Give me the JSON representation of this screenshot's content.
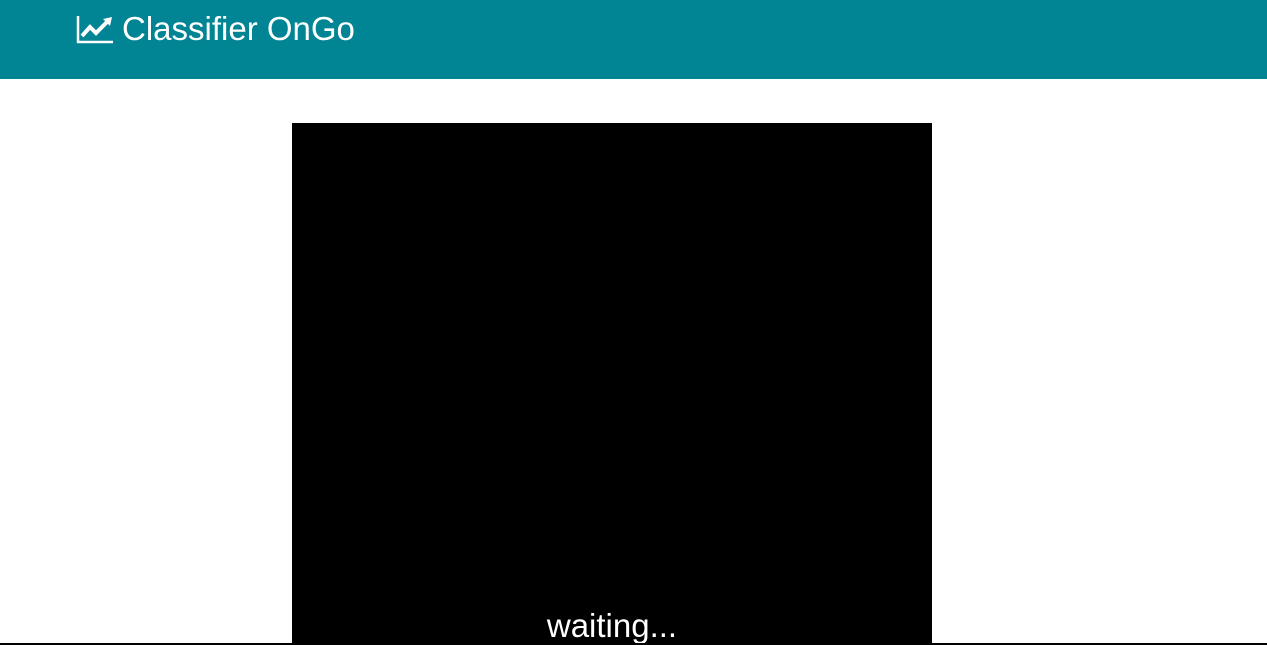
{
  "header": {
    "title": "Classifier OnGo",
    "icon": "chart-line-icon",
    "background_color": "#018493"
  },
  "main": {
    "video_panel": {
      "status": "waiting...",
      "background_color": "#000000"
    }
  }
}
